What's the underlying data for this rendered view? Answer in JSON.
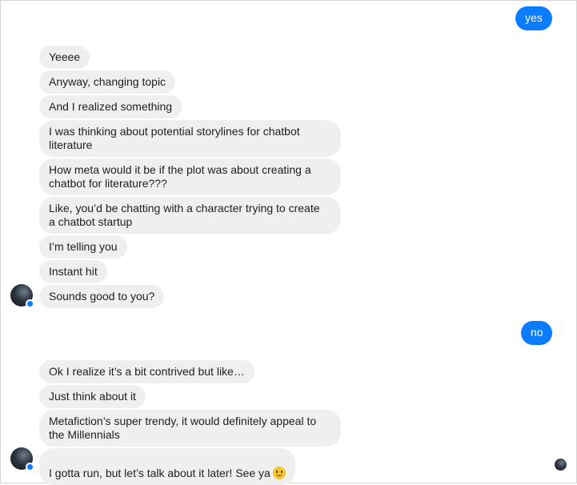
{
  "conversation": {
    "outgoing_1": "yes",
    "incoming_1": [
      "Yeeee",
      "Anyway, changing topic",
      "And I realized something",
      "I was thinking about potential storylines for chatbot\nliterature",
      "How meta would it be if the plot was about creating a\nchatbot for literature???",
      "Like, you’d be chatting with a character trying to create\na chatbot startup",
      "I’m telling you",
      "Instant hit",
      "Sounds good to you?"
    ],
    "outgoing_2": "no",
    "incoming_2": [
      "Ok I realize it’s a bit contrived but like…",
      "Just think about it",
      "Metafiction’s super trendy, it would definitely appeal to\nthe Millennials",
      "I gotta run, but let’s talk about it later! See ya"
    ],
    "last_message_emoji": "slightly-smiling-face-icon",
    "colors": {
      "outgoing_bubble": "#0a7cff",
      "incoming_bubble": "#efefef",
      "messenger_badge": "#0a7cff"
    }
  }
}
